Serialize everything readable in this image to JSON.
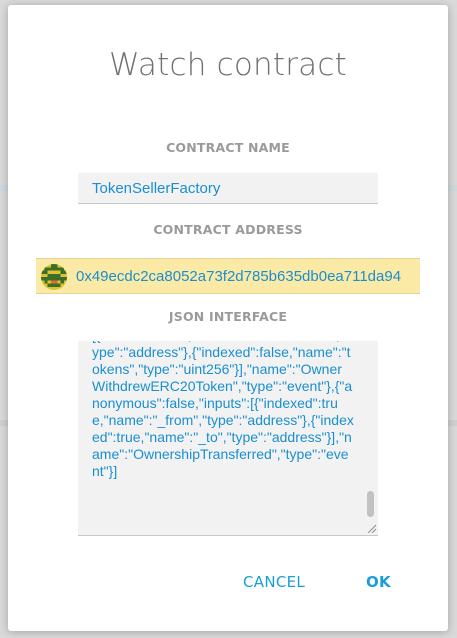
{
  "dialog": {
    "title": "Watch contract",
    "contract_name": {
      "label": "CONTRACT NAME",
      "value": "TokenSellerFactory"
    },
    "contract_address": {
      "label": "CONTRACT ADDRESS",
      "value": "0x49ecdc2ca8052a73f2d785b635db0ea711da94"
    },
    "json_interface": {
      "label": "JSON INTERFACE",
      "value": "[{\"indexed\":true,\"name\":\"tokenAddress\",\"type\":\"address\"},{\"indexed\":false,\"name\":\"tokens\",\"type\":\"uint256\"}],\"name\":\"OwnerWithdrewERC20Token\",\"type\":\"event\"},{\"anonymous\":false,\"inputs\":[{\"indexed\":true,\"name\":\"_from\",\"type\":\"address\"},{\"indexed\":true,\"name\":\"_to\",\"type\":\"address\"}],\"name\":\"OwnershipTransferred\",\"type\":\"event\"}]"
    },
    "buttons": {
      "cancel": "CANCEL",
      "ok": "OK"
    }
  },
  "colors": {
    "accent": "#1a9ed8",
    "address_highlight": "#fbe9a6",
    "label_gray": "#9a9a9a"
  }
}
